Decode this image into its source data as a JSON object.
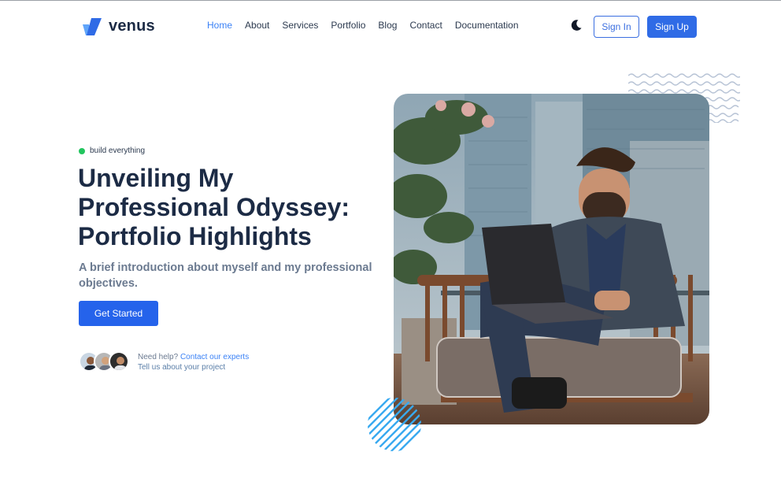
{
  "brand": {
    "name": "venus",
    "accent": "#2f6be6",
    "logo_colors": [
      "#2f6be6",
      "#60a5fa"
    ]
  },
  "nav": {
    "items": [
      {
        "label": "Home",
        "active": true
      },
      {
        "label": "About",
        "active": false
      },
      {
        "label": "Services",
        "active": false
      },
      {
        "label": "Portfolio",
        "active": false
      },
      {
        "label": "Blog",
        "active": false
      },
      {
        "label": "Contact",
        "active": false
      },
      {
        "label": "Documentation",
        "active": false
      }
    ],
    "theme_toggle_icon": "moon-icon",
    "sign_in_label": "Sign In",
    "sign_up_label": "Sign Up"
  },
  "hero": {
    "badge": "build everything",
    "badge_color": "#22c55e",
    "title_lines": [
      "Unveiling My",
      "Professional Odyssey:",
      "Portfolio Highlights"
    ],
    "subtitle": "A brief introduction about myself and my professional objectives.",
    "cta_label": "Get Started",
    "help_prefix": "Need help?",
    "help_link": "Contact our experts",
    "help_line2": "Tell us about your project",
    "image_subject": "man-with-laptop-photo"
  }
}
